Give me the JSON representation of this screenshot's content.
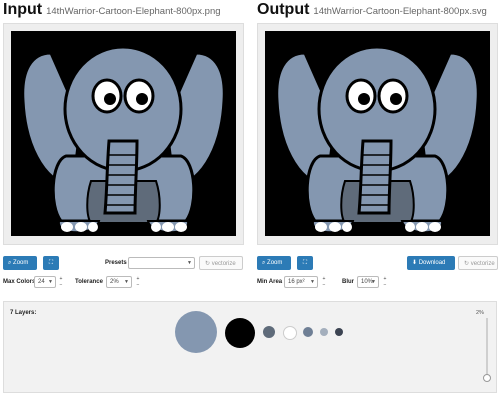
{
  "input": {
    "title": "Input",
    "filename": "14thWarrior-Cartoon-Elephant-800px.png",
    "zoom_label": "Zoom",
    "fit_icon": "fullscreen-icon",
    "presets_label": "Presets",
    "presets_value": "",
    "vectorize_label": "vectorize",
    "max_colors_label": "Max Colors",
    "max_colors_value": "24",
    "tolerance_label": "Tolerance",
    "tolerance_value": "2%"
  },
  "output": {
    "title": "Output",
    "filename": "14thWarrior-Cartoon-Elephant-800px.svg",
    "zoom_label": "Zoom",
    "fit_icon": "fullscreen-icon",
    "download_label": "Download",
    "vectorize_label": "vectorize",
    "min_area_label": "Min Area",
    "min_area_value": "16 px²",
    "blur_label": "Blur",
    "blur_value": "10%"
  },
  "layers": {
    "label": "7 Layers:",
    "slider_value_label": "2%",
    "swatches": [
      "#8497b0",
      "#000000",
      "#5f6b7a",
      "#ffffff",
      "#6f7f95",
      "#a4afbd",
      "#3c4452"
    ]
  },
  "colors": {
    "accent": "#2c7bb6",
    "elephant_body": "#8497b0",
    "elephant_shade": "#5f6b7a",
    "outline": "#000000"
  }
}
